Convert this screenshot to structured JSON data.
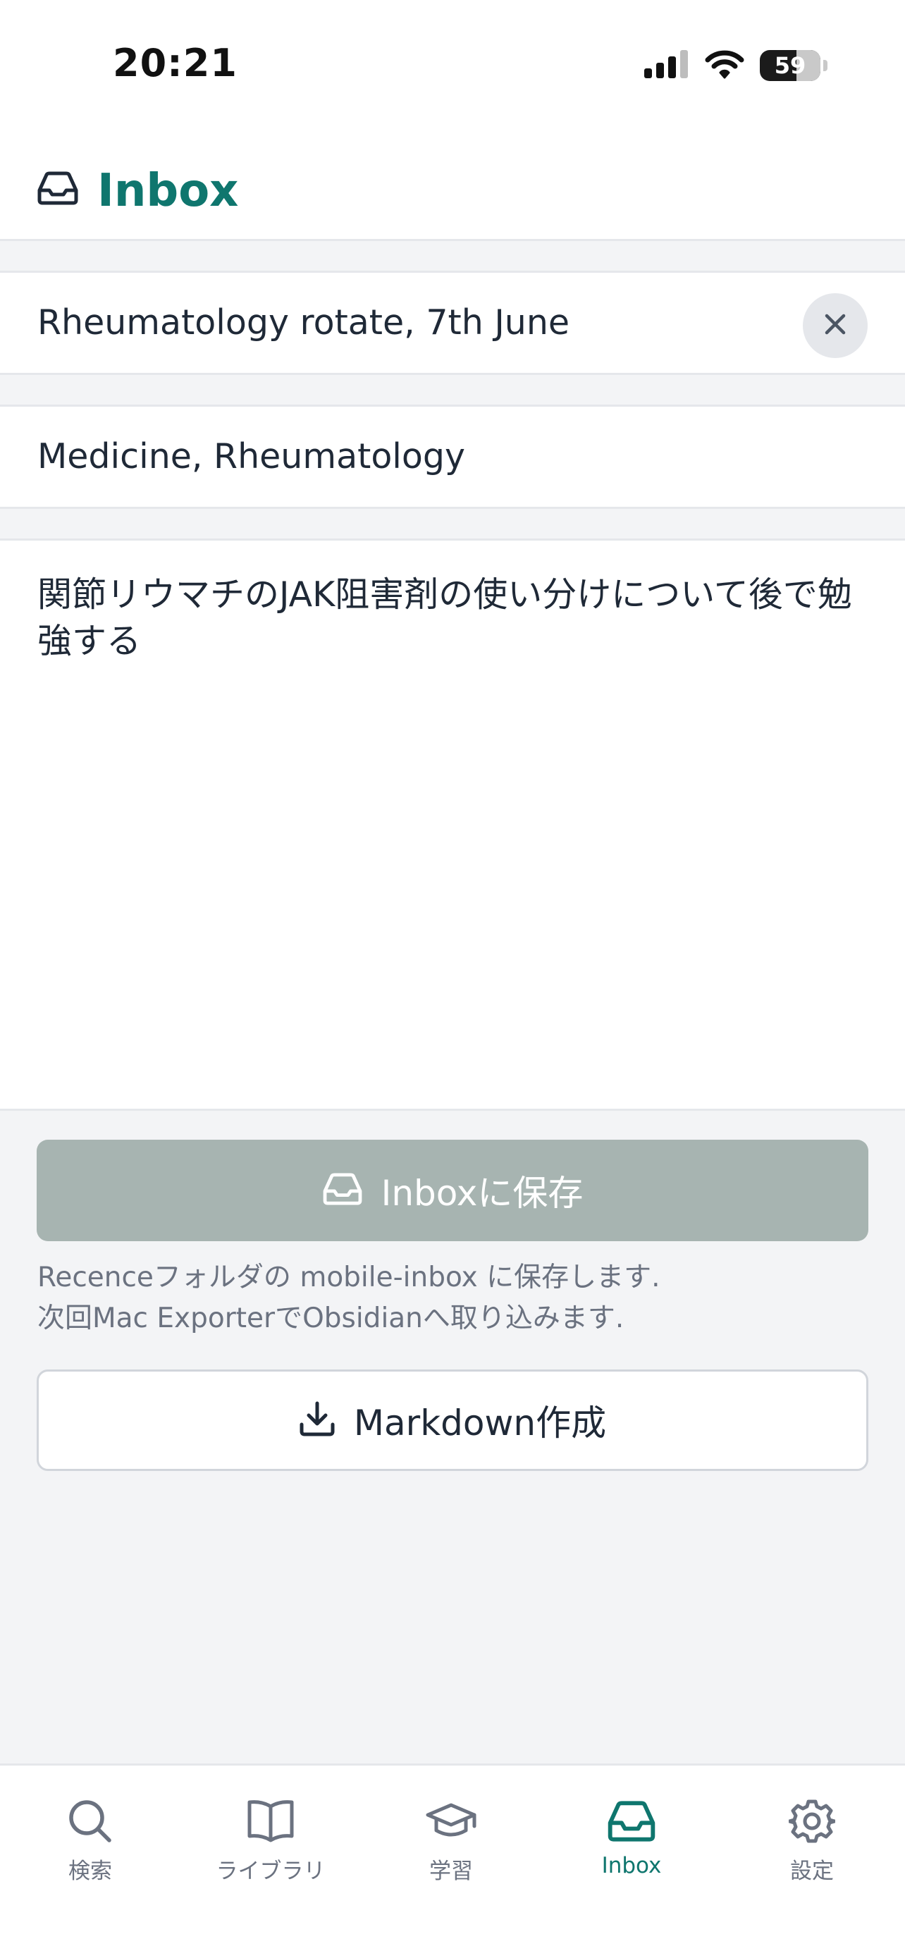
{
  "status_bar": {
    "time": "20:21",
    "battery": "59",
    "icons": [
      "signal-icon",
      "wifi-icon",
      "battery-icon"
    ]
  },
  "header": {
    "icon": "inbox-icon",
    "title": "Inbox"
  },
  "form": {
    "title_value": "Rheumatology rotate, 7th June",
    "tags_value": "Medicine, Rheumatology",
    "body_value": "関節リウマチのJAK阻害剤の使い分けについて後で勉強する",
    "clear_icon": "close-icon"
  },
  "actions": {
    "save_label": "Inboxに保存",
    "save_icon": "inbox-icon",
    "hint_line1": "Recenceフォルダの mobile-inbox に保存します.",
    "hint_line2": "次回Mac ExporterでObsidianへ取り込みます.",
    "markdown_label": "Markdown作成",
    "markdown_icon": "download-icon"
  },
  "tabs": [
    {
      "label": "検索",
      "icon": "search-icon",
      "active": false
    },
    {
      "label": "ライブラリ",
      "icon": "book-icon",
      "active": false
    },
    {
      "label": "学習",
      "icon": "graduation-cap-icon",
      "active": false
    },
    {
      "label": "Inbox",
      "icon": "inbox-icon",
      "active": true
    },
    {
      "label": "設定",
      "icon": "gear-icon",
      "active": false
    }
  ],
  "colors": {
    "accent": "#0f766e",
    "save_button_disabled": "#a7b4b1",
    "background": "#f3f4f6",
    "muted_text": "#6b7280"
  }
}
